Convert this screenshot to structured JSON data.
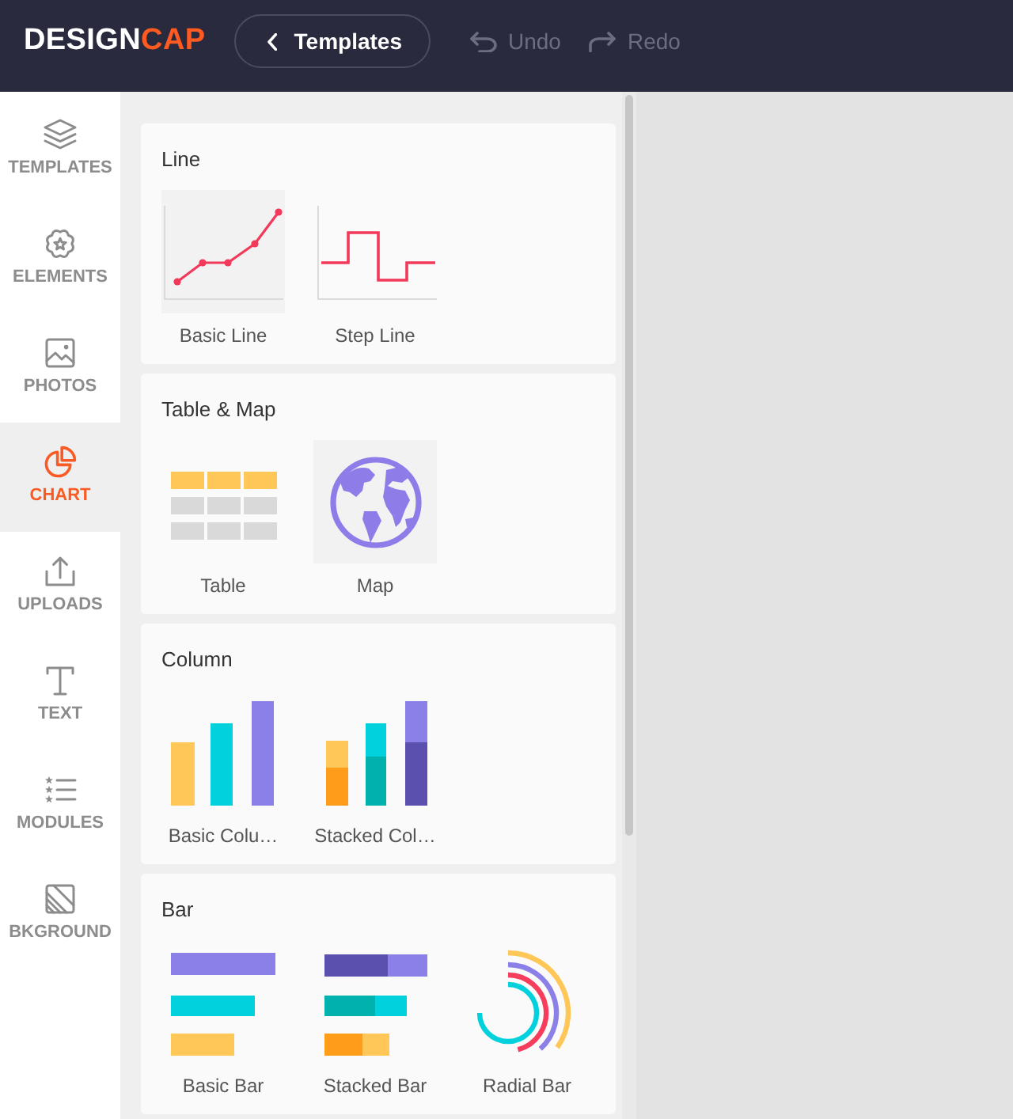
{
  "header": {
    "logo": {
      "text": "DESIGN",
      "accent": "CAP"
    },
    "back_button": {
      "label": "Templates"
    },
    "actions": [
      {
        "kind": "undo",
        "label": "Undo",
        "disabled": true
      },
      {
        "kind": "redo",
        "label": "Redo",
        "disabled": true
      }
    ]
  },
  "sidebar": {
    "items": [
      {
        "kind": "templates",
        "label": "TEMPLATES",
        "selected": false
      },
      {
        "kind": "elements",
        "label": "ELEMENTS",
        "selected": false
      },
      {
        "kind": "photos",
        "label": "PHOTOS",
        "selected": false
      },
      {
        "kind": "chart",
        "label": "CHART",
        "selected": true
      },
      {
        "kind": "uploads",
        "label": "UPLOADS",
        "selected": false
      },
      {
        "kind": "text",
        "label": "TEXT",
        "selected": false
      },
      {
        "kind": "modules",
        "label": "MODULES",
        "selected": false
      },
      {
        "kind": "background",
        "label": "BKGROUND",
        "selected": false
      }
    ]
  },
  "chart_panel": {
    "sections": [
      {
        "title": "Line",
        "items": [
          {
            "kind": "basic-line",
            "label": "Basic Line"
          },
          {
            "kind": "step-line",
            "label": "Step Line"
          }
        ]
      },
      {
        "title": "Table & Map",
        "items": [
          {
            "kind": "table",
            "label": "Table"
          },
          {
            "kind": "map",
            "label": "Map"
          }
        ]
      },
      {
        "title": "Column",
        "items": [
          {
            "kind": "basic-column",
            "label": "Basic Colu…"
          },
          {
            "kind": "stacked-column",
            "label": "Stacked Col…"
          }
        ]
      },
      {
        "title": "Bar",
        "items": [
          {
            "kind": "basic-bar",
            "label": "Basic Bar"
          },
          {
            "kind": "stacked-bar",
            "label": "Stacked Bar"
          },
          {
            "kind": "radial-bar",
            "label": "Radial Bar"
          }
        ]
      }
    ]
  }
}
